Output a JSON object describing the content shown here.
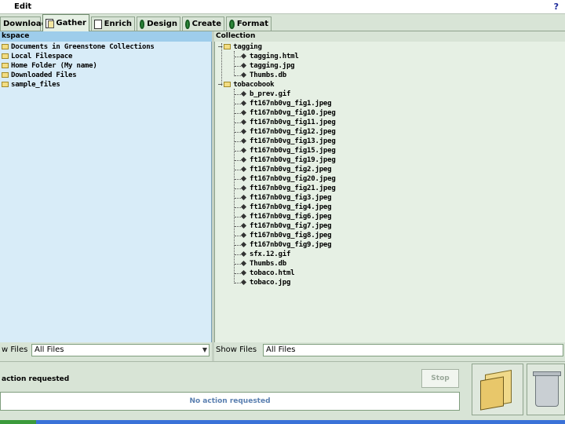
{
  "menu": {
    "edit_label": "Edit"
  },
  "tabs": [
    {
      "label": "Download"
    },
    {
      "label": "Gather"
    },
    {
      "label": "Enrich"
    },
    {
      "label": "Design"
    },
    {
      "label": "Create"
    },
    {
      "label": "Format"
    }
  ],
  "workspace": {
    "header": "kspace",
    "items": [
      "Documents in Greenstone Collections",
      "Local Filespace",
      "Home Folder (My name)",
      "Downloaded Files",
      "sample_files"
    ],
    "filter_label": "w Files",
    "filter_value": "All Files"
  },
  "collection": {
    "header": "Collection",
    "folder1": {
      "name": "tagging",
      "files": [
        "tagging.html",
        "tagging.jpg",
        "Thumbs.db"
      ]
    },
    "folder2": {
      "name": "tobacobook",
      "files": [
        "b_prev.gif",
        "ft167nb0vg_fig1.jpeg",
        "ft167nb0vg_fig10.jpeg",
        "ft167nb0vg_fig11.jpeg",
        "ft167nb0vg_fig12.jpeg",
        "ft167nb0vg_fig13.jpeg",
        "ft167nb0vg_fig15.jpeg",
        "ft167nb0vg_fig19.jpeg",
        "ft167nb0vg_fig2.jpeg",
        "ft167nb0vg_fig20.jpeg",
        "ft167nb0vg_fig21.jpeg",
        "ft167nb0vg_fig3.jpeg",
        "ft167nb0vg_fig4.jpeg",
        "ft167nb0vg_fig6.jpeg",
        "ft167nb0vg_fig7.jpeg",
        "ft167nb0vg_fig8.jpeg",
        "ft167nb0vg_fig9.jpeg",
        "sfx.12.gif",
        "Thumbs.db",
        "tobaco.html",
        "tobaco.jpg"
      ]
    },
    "filter_label": "Show Files",
    "filter_value": "All Files"
  },
  "status": {
    "label": "action requested",
    "stop_label": "Stop",
    "progress_text": "No action requested"
  }
}
